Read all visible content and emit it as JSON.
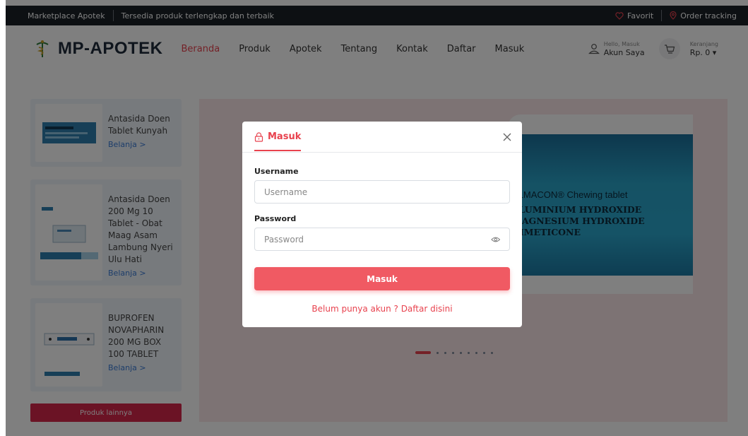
{
  "topbar": {
    "brand": "Marketplace Apotek",
    "tagline": "Tersedia produk terlengkap dan terbaik",
    "favorit": "Favorit",
    "order_tracking": "Order tracking"
  },
  "header": {
    "logo_text": "MP-APOTEK",
    "nav": [
      "Beranda",
      "Produk",
      "Apotek",
      "Tentang",
      "Kontak",
      "Daftar",
      "Masuk"
    ],
    "account_small": "Hello, Masuk",
    "account_big": "Akun Saya",
    "cart_small": "Keranjang",
    "cart_big": "Rp. 0 ▾"
  },
  "products": [
    {
      "name": "Antasida Doen Tablet Kunyah",
      "shop": "Belanja  >"
    },
    {
      "name": "Antasida Doen 200 Mg 10 Tablet - Obat Maag Asam Lambung Nyeri Ulu Hati",
      "shop": "Belanja  >"
    },
    {
      "name": "BUPROFEN NOVAPHARIN 200 MG BOX 100 TABLET",
      "shop": "Belanja  >"
    }
  ],
  "more_button": "Produk lainnya",
  "banner": {
    "line1": "ALMACON",
    "line1_suffix": "® Chewing tablet",
    "line2": "ALUMINIUM HYDROXIDE",
    "line3": "MAGNESIUM HYDROXIDE",
    "line4": "DIMETICONE"
  },
  "modal": {
    "tab_label": "Masuk",
    "username_label": "Username",
    "username_placeholder": "Username",
    "password_label": "Password",
    "password_placeholder": "Password",
    "submit_label": "Masuk",
    "register_text": "Belum punya akun ? Daftar disini"
  },
  "colors": {
    "accent": "#e8424e",
    "button": "#f05a63",
    "topbar": "#1a2027"
  }
}
